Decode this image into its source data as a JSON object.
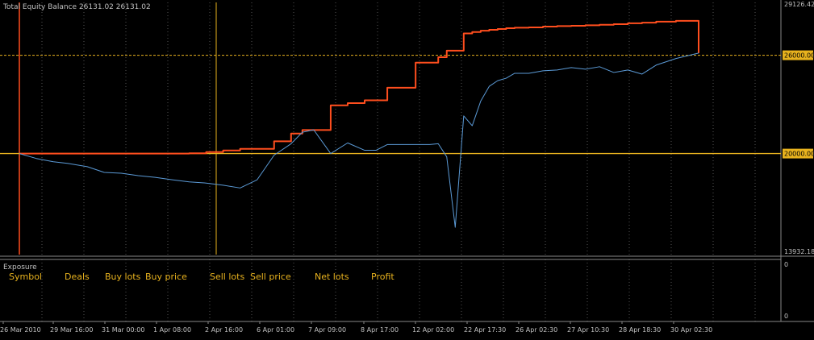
{
  "chart_data": {
    "type": "line",
    "title": "Total Equity Balance 26131.02 26131.02",
    "x": [
      0,
      6,
      12,
      17,
      24,
      30,
      36,
      42,
      48,
      54,
      60,
      66,
      72,
      78,
      84,
      90,
      96,
      100,
      104,
      110,
      116,
      122,
      126,
      130,
      135,
      140,
      145,
      148,
      151,
      154,
      157,
      160,
      163,
      166,
      169,
      172,
      175,
      180,
      185,
      190,
      195,
      200,
      205,
      210,
      215,
      220,
      225,
      232,
      240
    ],
    "x_tick_labels": [
      "26 Mar 2010",
      "29 Mar 16:00",
      "31 Mar 00:00",
      "1 Apr 08:00",
      "2 Apr 16:00",
      "6 Apr 01:00",
      "7 Apr 09:00",
      "8 Apr 17:00",
      "12 Apr 02:00",
      "22 Apr 17:30",
      "26 Apr 02:30",
      "27 Apr 10:30",
      "28 Apr 18:30",
      "30 Apr 02:30"
    ],
    "series": [
      {
        "name": "Balance",
        "color": "#ff4e1e",
        "values": [
          20000,
          20000,
          20000,
          20000,
          20000,
          20000,
          20000,
          20000,
          20000,
          20000,
          20020,
          20090,
          20190,
          20290,
          20290,
          20750,
          21220,
          21440,
          21440,
          22940,
          23080,
          23250,
          23250,
          24020,
          24020,
          25550,
          25550,
          25880,
          26280,
          26280,
          27330,
          27420,
          27500,
          27550,
          27600,
          27650,
          27680,
          27700,
          27750,
          27780,
          27800,
          27830,
          27860,
          27900,
          27950,
          27990,
          28050,
          28100,
          26131
        ]
      },
      {
        "name": "Equity",
        "color": "#5b9ad6",
        "values": [
          20000,
          19700,
          19500,
          19400,
          19200,
          18850,
          18800,
          18650,
          18550,
          18400,
          18270,
          18200,
          18070,
          17900,
          18400,
          19900,
          20600,
          21300,
          21450,
          20000,
          20650,
          20200,
          20200,
          20550,
          20550,
          20550,
          20550,
          20600,
          19800,
          15500,
          22300,
          21700,
          23200,
          24100,
          24450,
          24600,
          24900,
          24900,
          25050,
          25100,
          25250,
          25150,
          25300,
          24950,
          25100,
          24850,
          25400,
          25800,
          26131
        ]
      }
    ],
    "ylim": [
      13932.18,
      29126.42
    ],
    "y_tick_labels": [
      "29126.42",
      "26000.00",
      "20000.00",
      "13932.18"
    ],
    "hlines": [
      26000,
      20000
    ],
    "hline_labels": [
      "26000.00",
      "20000.00"
    ],
    "grid": true,
    "grid_color": "#555555",
    "level_color": "#e8b21e",
    "background": "#000000",
    "axis_label_color": "#c0c0c0"
  },
  "exposure": {
    "title": "Exposure",
    "columns": [
      "Symbol",
      "Deals",
      "Buy lots",
      "Buy price",
      "Sell lots",
      "Sell price",
      "Net lots",
      "Profit"
    ],
    "y_tick_labels": [
      "0",
      "0"
    ],
    "column_color": "#e8b21e"
  }
}
